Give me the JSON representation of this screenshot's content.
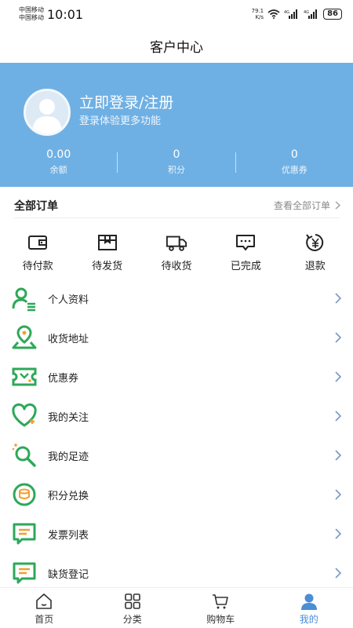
{
  "status_bar": {
    "carrier_1": "中国移动",
    "carrier_2": "中国移动",
    "time": "10:01",
    "speed_value": "79.1",
    "speed_unit": "K/s",
    "battery": "86"
  },
  "header": {
    "title": "客户中心"
  },
  "profile": {
    "login_title": "立即登录/注册",
    "login_subtitle": "登录体验更多功能",
    "stats": [
      {
        "value": "0.00",
        "label": "余额"
      },
      {
        "value": "0",
        "label": "积分"
      },
      {
        "value": "0",
        "label": "优惠券"
      }
    ]
  },
  "orders": {
    "title": "全部订单",
    "view_all": "查看全部订单",
    "items": [
      {
        "label": "待付款",
        "icon": "wallet-icon"
      },
      {
        "label": "待发货",
        "icon": "package-icon"
      },
      {
        "label": "待收货",
        "icon": "truck-icon"
      },
      {
        "label": "已完成",
        "icon": "chat-complete-icon"
      },
      {
        "label": "退款",
        "icon": "refund-yen-icon"
      }
    ]
  },
  "menu": {
    "items": [
      {
        "label": "个人资料",
        "icon": "profile-icon"
      },
      {
        "label": "收货地址",
        "icon": "location-icon"
      },
      {
        "label": "优惠券",
        "icon": "coupon-icon"
      },
      {
        "label": "我的关注",
        "icon": "heart-icon"
      },
      {
        "label": "我的足迹",
        "icon": "footprint-icon"
      },
      {
        "label": "积分兑换",
        "icon": "points-exchange-icon"
      },
      {
        "label": "发票列表",
        "icon": "invoice-icon"
      },
      {
        "label": "缺货登记",
        "icon": "stockout-register-icon"
      }
    ]
  },
  "tabbar": {
    "items": [
      {
        "label": "首页",
        "icon": "home-icon"
      },
      {
        "label": "分类",
        "icon": "category-grid-icon"
      },
      {
        "label": "购物车",
        "icon": "cart-icon"
      },
      {
        "label": "我的",
        "icon": "user-icon",
        "active": true
      }
    ]
  },
  "colors": {
    "header_blue": "#6fb0e4",
    "icon_green": "#2ea85a",
    "active_tab": "#4a8ed6"
  }
}
